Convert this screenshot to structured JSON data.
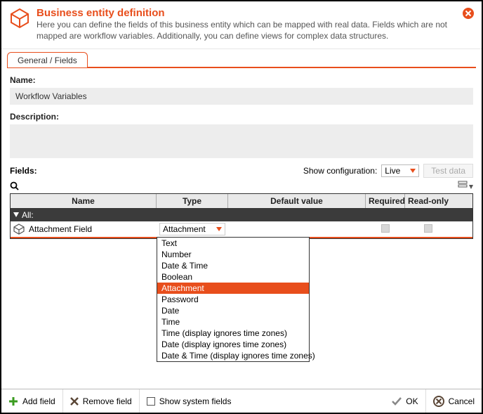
{
  "header": {
    "title": "Business entity definition",
    "description": "Here you can define the fields of this business entity which can be mapped with real data. Fields which are not mapped are workflow variables. Additionally, you can define views for complex data structures."
  },
  "tabs": {
    "general": "General / Fields"
  },
  "labels": {
    "name": "Name:",
    "description": "Description:",
    "fields": "Fields:",
    "show_cfg": "Show configuration:",
    "test_data": "Test data",
    "all": "All:"
  },
  "form": {
    "name_value": "Workflow Variables",
    "description_value": ""
  },
  "config": {
    "selected": "Live"
  },
  "columns": {
    "name": "Name",
    "type": "Type",
    "default_value": "Default value",
    "required": "Required",
    "read_only": "Read-only"
  },
  "row": {
    "name": "Attachment Field",
    "type": "Attachment"
  },
  "type_options": [
    "Text",
    "Number",
    "Date & Time",
    "Boolean",
    "Attachment",
    "Password",
    "Date",
    "Time",
    "Time (display ignores time zones)",
    "Date (display ignores time zones)",
    "Date & Time (display ignores time zones)"
  ],
  "type_selected": "Attachment",
  "footer": {
    "add_field": "Add field",
    "remove_field": "Remove field",
    "show_system": "Show system fields",
    "ok": "OK",
    "cancel": "Cancel"
  }
}
